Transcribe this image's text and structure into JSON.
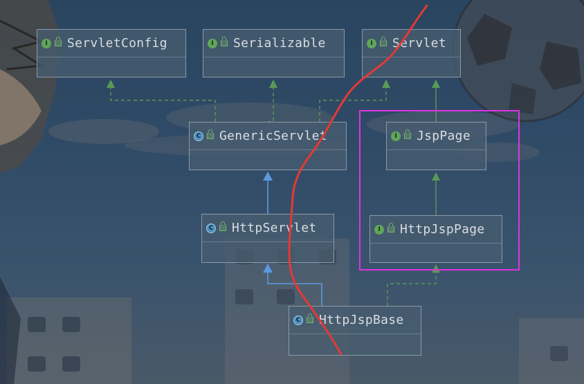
{
  "diagram": {
    "nodes": {
      "servlet_config": {
        "label": "ServletConfig",
        "badge": "I",
        "kind": "interface"
      },
      "serializable": {
        "label": "Serializable",
        "badge": "I",
        "kind": "interface"
      },
      "servlet": {
        "label": "Servlet",
        "badge": "I",
        "kind": "interface"
      },
      "generic_servlet": {
        "label": "GenericServlet",
        "badge": "C",
        "kind": "class"
      },
      "jsp_page": {
        "label": "JspPage",
        "badge": "I",
        "kind": "interface"
      },
      "http_servlet": {
        "label": "HttpServlet",
        "badge": "C",
        "kind": "class"
      },
      "http_jsp_page": {
        "label": "HttpJspPage",
        "badge": "I",
        "kind": "interface"
      },
      "http_jsp_base": {
        "label": "HttpJspBase",
        "badge": "C",
        "kind": "class"
      }
    },
    "colors": {
      "implements_edge": "#5a9a56",
      "extends_edge": "#5a9ae0",
      "highlight_box": "#e033e0",
      "annotation_stroke": "#e53935"
    }
  }
}
